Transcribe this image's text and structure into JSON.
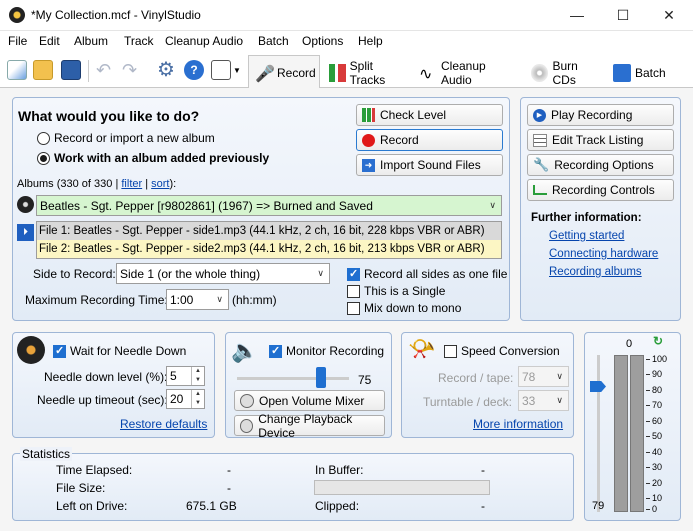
{
  "window": {
    "title": "*My Collection.mcf - VinylStudio",
    "minimize": "—",
    "maximize": "☐",
    "close": "✕"
  },
  "menu": [
    "File",
    "Edit",
    "Album",
    "Track",
    "Cleanup Audio",
    "Batch",
    "Options",
    "Help"
  ],
  "tabs": [
    {
      "label": "Record"
    },
    {
      "label": "Split Tracks"
    },
    {
      "label": "Cleanup Audio"
    },
    {
      "label": "Burn CDs"
    },
    {
      "label": "Batch"
    }
  ],
  "main": {
    "question": "What would you like to do?",
    "radio1": "Record or import a new album",
    "radio2": "Work with an album added previously",
    "albums_label": "Albums (330 of 330 | ",
    "filter": "filter",
    "sep": " | ",
    "sort": "sort",
    "close_paren": "):",
    "album_selected": "Beatles - Sgt. Pepper [r9802861] (1967) => Burned and Saved",
    "files": [
      "File 1: Beatles - Sgt. Pepper - side1.mp3 (44.1 kHz, 2 ch, 16 bit, 228 kbps VBR or ABR)",
      "File 2: Beatles - Sgt. Pepper - side2.mp3 (44.1 kHz, 2 ch, 16 bit, 213 kbps VBR or ABR)"
    ],
    "side_label": "Side to Record:",
    "side_value": "Side 1 (or the whole thing)",
    "max_label": "Maximum Recording Time:",
    "max_value": "1:00",
    "max_unit": "(hh:mm)",
    "chk_all_sides": "Record all sides as one file",
    "chk_single": "This is a Single",
    "chk_mono": "Mix down to mono",
    "btn_check": "Check Level",
    "btn_record": "Record",
    "btn_import": "Import Sound Files"
  },
  "side": {
    "play": "Play Recording",
    "edit": "Edit Track Listing",
    "options": "Recording Options",
    "controls": "Recording Controls",
    "further": "Further information:",
    "links": [
      "Getting started",
      "Connecting hardware",
      "Recording albums"
    ]
  },
  "needle": {
    "wait": "Wait for Needle Down",
    "down_label": "Needle down level (%):",
    "down_value": "5",
    "up_label": "Needle up timeout (sec):",
    "up_value": "20",
    "restore": "Restore defaults"
  },
  "monitor": {
    "label": "Monitor Recording",
    "slider_value": "75",
    "slider_fraction": 0.75,
    "mixer": "Open Volume Mixer",
    "playback": "Change Playback Device"
  },
  "speed": {
    "label": "Speed Conversion",
    "record_label": "Record / tape:",
    "record_value": "78",
    "turntable_label": "Turntable / deck:",
    "turntable_value": "33",
    "more": "More information"
  },
  "meter": {
    "top_value": "0",
    "bottom_value": "79",
    "scale": [
      "100",
      "90",
      "80",
      "70",
      "60",
      "50",
      "40",
      "30",
      "20",
      "10",
      "0"
    ]
  },
  "stats": {
    "title": "Statistics",
    "elapsed_label": "Time Elapsed:",
    "elapsed": "-",
    "size_label": "File Size:",
    "size": "-",
    "drive_label": "Left on Drive:",
    "drive": "675.1 GB",
    "buffer_label": "In Buffer:",
    "buffer": "-",
    "clipped_label": "Clipped:",
    "clipped": "-"
  }
}
